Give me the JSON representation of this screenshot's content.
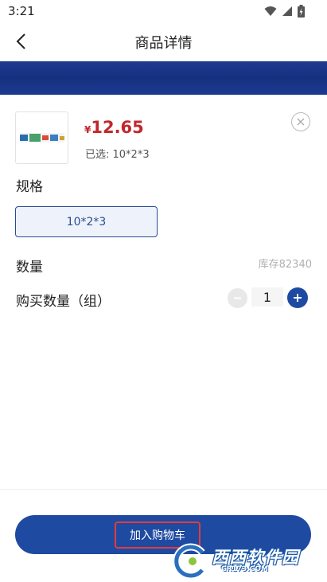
{
  "status_bar": {
    "time": "3:21"
  },
  "header": {
    "title": "商品详情"
  },
  "product": {
    "currency_symbol": "¥",
    "price": "12.65",
    "selected_text": "已选: 10*2*3"
  },
  "spec": {
    "label": "规格",
    "options": [
      "10*2*3"
    ]
  },
  "quantity": {
    "label": "数量",
    "stock_text": "库存82340",
    "buy_label": "购买数量（组）",
    "value": "1"
  },
  "footer": {
    "add_to_cart_label": "加入购物车"
  },
  "watermark": {
    "brand": "西西软件园",
    "domain": "CR173.COM"
  },
  "colors": {
    "primary": "#1f4aa2",
    "price": "#c0282d",
    "banner": "#1c3a91"
  }
}
